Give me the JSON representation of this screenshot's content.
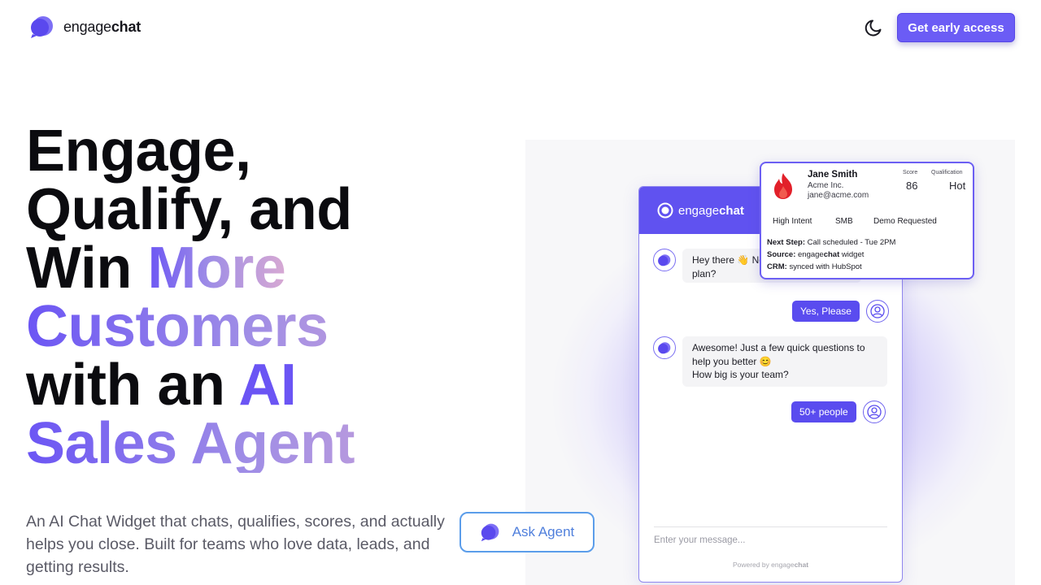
{
  "header": {
    "logo_prefix": "engage",
    "logo_bold": "chat",
    "theme_icon": "moon-icon",
    "cta_label": "Get early access"
  },
  "hero": {
    "title_line1": "Engage,",
    "title_line2": "Qualify, and",
    "title_line3a": "Win ",
    "title_line3b": "More",
    "title_line4": "Customers",
    "title_line5a": "with an ",
    "title_line5b": "AI",
    "title_line6": "Sales Agent",
    "subtitle": "An AI Chat Widget that chats, qualifies, scores, and actually helps you close. Built for teams who love data, leads, and getting results.",
    "ask_agent_label": "Ask Agent"
  },
  "widget": {
    "brand_prefix": "engage",
    "brand_bold": "chat",
    "messages": [
      {
        "from": "bot",
        "text": "Hey there 👋 Need help choosing a plan?"
      },
      {
        "from": "user",
        "text": "Yes, Please"
      },
      {
        "from": "bot",
        "line1": "Awesome! Just a few quick questions to",
        "line2": "help you better 😊",
        "line3": "How big is your team?"
      },
      {
        "from": "user",
        "text": "50+ people"
      }
    ],
    "bot_msg1_line1": "Hey there 👋 Ne",
    "bot_msg1_line2": "plan?",
    "input_placeholder": "Enter your message...",
    "powered_by_prefix": "Powered by engage",
    "powered_by_bold": "chat"
  },
  "lead_card": {
    "name": "Jane Smith",
    "company": "Acme Inc.",
    "email": "jane@acme.com",
    "score_label": "Score",
    "score_value": "86",
    "qualification_label": "Qualification",
    "qualification_value": "Hot",
    "tags": [
      "High Intent",
      "SMB",
      "Demo Requested"
    ],
    "next_step_label": "Next Step:",
    "next_step_value": " Call scheduled - Tue 2PM",
    "source_label": "Source:",
    "source_value_prefix": " engage",
    "source_value_bold": "chat",
    "source_value_suffix": " widget",
    "crm_label": "CRM:",
    "crm_value": " synced with HubSpot"
  },
  "colors": {
    "brand": "#6052f0",
    "cta": "#6b5cf5",
    "ask_agent_border": "#5b9dea",
    "gradient_start": "#6b55f4",
    "gradient_end": "#d7a9d3"
  }
}
